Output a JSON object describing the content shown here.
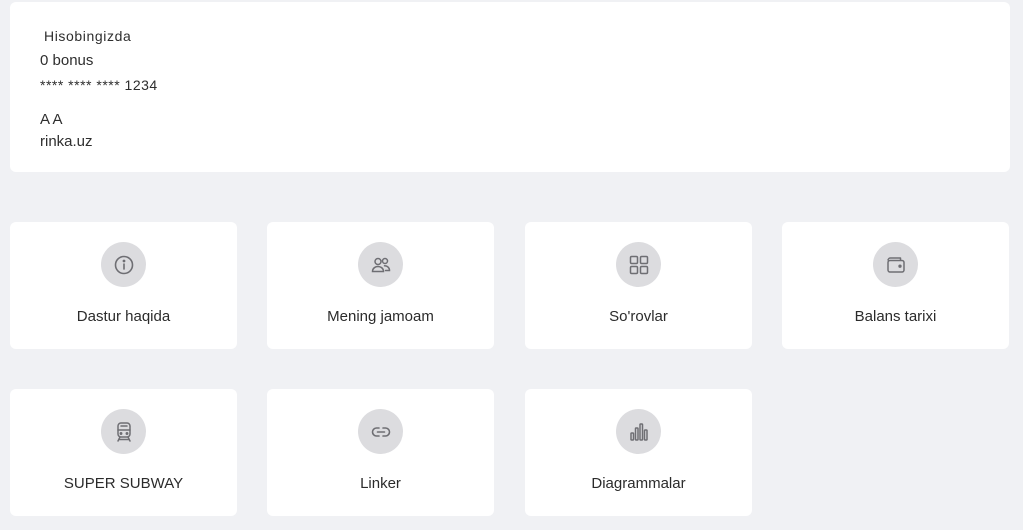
{
  "account": {
    "title": "Hisobingizda",
    "bonus": "0 bonus",
    "card_number": "**** **** **** 1234",
    "name": "A A",
    "site": "rinka.uz"
  },
  "tiles": [
    {
      "label": "Dastur haqida",
      "icon": "info-icon"
    },
    {
      "label": "Mening jamoam",
      "icon": "team-icon"
    },
    {
      "label": "So'rovlar",
      "icon": "grid-icon"
    },
    {
      "label": "Balans tarixi",
      "icon": "wallet-icon"
    },
    {
      "label": "SUPER SUBWAY",
      "icon": "train-icon"
    },
    {
      "label": "Linker",
      "icon": "link-icon"
    },
    {
      "label": "Diagrammalar",
      "icon": "bar-chart-icon"
    }
  ],
  "colors": {
    "background": "#f0f1f4",
    "card": "#ffffff",
    "icon_circle": "#dcdcdf",
    "icon_stroke": "#6e6e73",
    "text": "#2b2b2b"
  }
}
